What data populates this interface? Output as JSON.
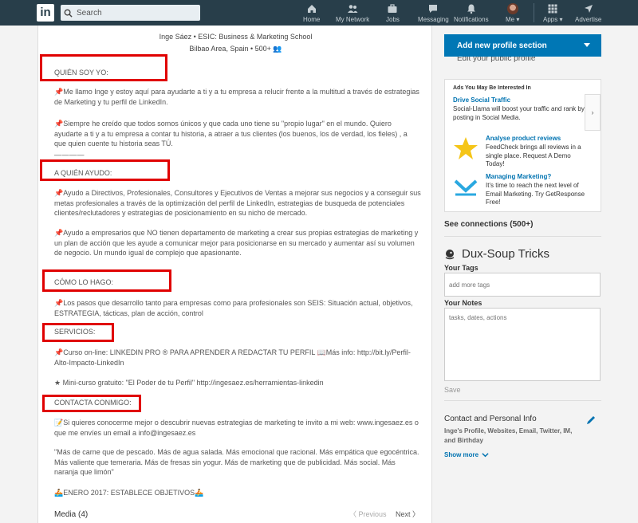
{
  "nav": {
    "logo": "in",
    "search_placeholder": "Search",
    "items": [
      {
        "label": "Home",
        "icon": "home-icon"
      },
      {
        "label": "My Network",
        "icon": "network-icon"
      },
      {
        "label": "Jobs",
        "icon": "briefcase-icon"
      },
      {
        "label": "Messaging",
        "icon": "chat-icon"
      },
      {
        "label": "Notifications",
        "icon": "bell-icon"
      },
      {
        "label": "Me ▾",
        "icon": "avatar"
      },
      {
        "label": "Apps ▾",
        "icon": "grid-icon"
      },
      {
        "label": "Advertise",
        "icon": "compass-icon"
      }
    ]
  },
  "profile": {
    "headline": "Inge Sáez  •  ESIC: Business & Marketing School",
    "location": "Bilbao Area, Spain  •  500+ 👥",
    "sections": [
      "QUIÉN SOY YO:",
      "A QUIÉN AYUDO:",
      "CÓMO LO HAGO:",
      "SERVICIOS:",
      "CONTACTA CONMIGO:"
    ],
    "paragraphs": [
      "📌Me llamo Inge y estoy aquí para ayudarte a ti y a tu empresa a relucir frente a la multitud a través de estrategias de Marketing y tu perfil de LinkedIn.",
      "📌Siempre he creído que todos somos únicos y que cada uno tiene su \"propio lugar\" en el mundo. Quiero ayudarte a ti y a tu empresa a contar tu historia, a atraer a tus clientes (los buenos, los de verdad, los fieles) , a que quien cuente tu historia seas TÚ.",
      "📌Ayudo a Directivos, Profesionales, Consultores y Ejecutivos de Ventas a mejorar sus negocios y a conseguir sus metas profesionales a través de la optimización del perfil de LinkedIn, estrategias de busqueda de potenciales clientes/reclutadores y estrategias de posicionamiento en su nicho de mercado.",
      "📌Ayudo a empresarios que NO tienen departamento de marketing a crear sus propias estrategias de marketing y un plan de acción que les ayude a comunicar mejor para posicionarse en su mercado y aumentar así su volumen de negocio. Un mundo igual de complejo que apasionante.",
      "📌Los pasos que desarrollo tanto para empresas como para profesionales son SEIS: Situación actual, objetivos, ESTRATEGIA, tácticas, plan de acción, control",
      "📌Curso on-line: LINKEDIN PRO ® PARA APRENDER A REDACTAR TU PERFIL 📖Más info: http://bit.ly/Perfil-Alto-Impacto-LinkedIn",
      "★ Mini-curso gratuito: \"El Poder de tu Perfil\" http://ingesaez.es/herramientas-linkedin",
      "📝Si quieres conocerme mejor o descubrir nuevas estrategias de marketing te invito a mi web: www.ingesaez.es o que me envíes un email a info@ingesaez.es",
      "\"Más de carne que de pescado. Más de agua salada. Más emocional que racional. Más empática que egocéntrica. Más valiente que temeraria. Más de fresas sin yogur. Más de marketing que de publicidad. Más social. Más naranja que limón\"",
      "🚣ENERO 2017: ESTABLECE OBJETIVOS🚣"
    ],
    "dashes": "— — — —",
    "media_label": "Media (4)",
    "prev_label": "〈  Previous",
    "next_label": "Next  〉"
  },
  "sidebar": {
    "add_section_label": "Add new profile section",
    "edit_public_profile": "Edit your public profile",
    "ads": {
      "title": "Ads You May Be Interested In",
      "arrow": "›",
      "items": [
        {
          "title": "Drive Social Traffic",
          "desc": "Social-Llama will boost your traffic and rank by posting in Social Media."
        },
        {
          "title": "Analyse product reviews",
          "desc": "FeedCheck brings all reviews in a single place. Request A Demo Today!"
        },
        {
          "title": "Managing Marketing?",
          "desc": "It's time to reach the next level of Email Marketing. Try GetResponse Free!"
        }
      ]
    },
    "see_connections": "See connections (500+)",
    "dux_title": "Dux-Soup Tricks",
    "tags_label": "Your Tags",
    "tags_placeholder": "add more tags",
    "notes_label": "Your Notes",
    "notes_placeholder": "tasks, dates, actions",
    "save_label": "Save",
    "contact_title": "Contact and Personal Info",
    "contact_desc": "Inge's Profile, Websites, Email, Twitter, IM, and Birthday",
    "show_more": "Show more"
  },
  "colors": {
    "nav_bg": "#283e4a",
    "accent_blue": "#0077b5",
    "highlight_red": "#e00000"
  }
}
